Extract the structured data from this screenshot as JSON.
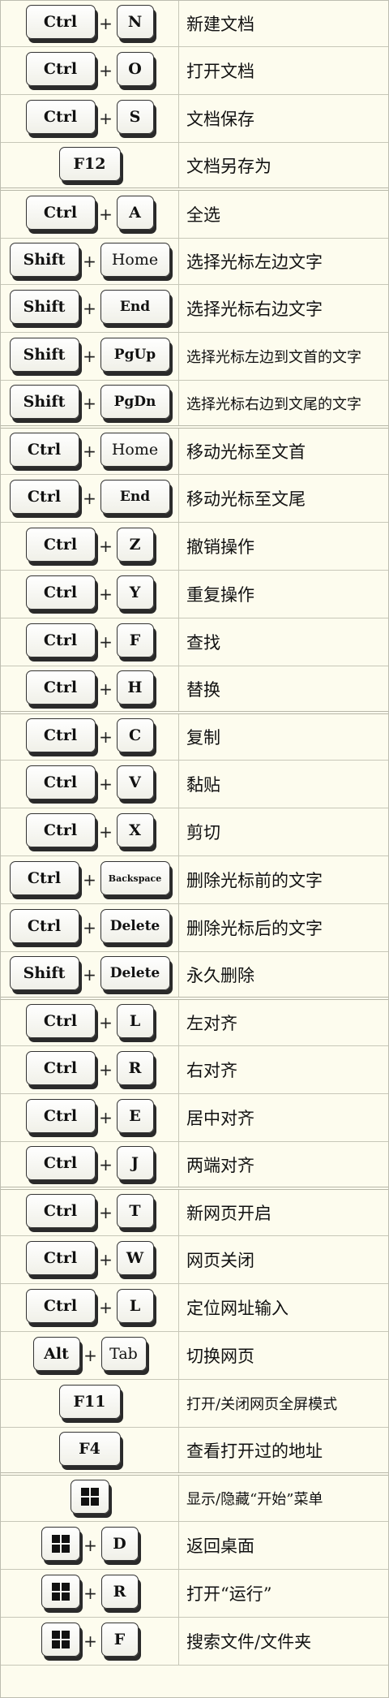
{
  "rows": [
    {
      "keys": [
        "Ctrl",
        "N"
      ],
      "desc": "新建文档"
    },
    {
      "keys": [
        "Ctrl",
        "O"
      ],
      "desc": "打开文档"
    },
    {
      "keys": [
        "Ctrl",
        "S"
      ],
      "desc": "文档保存"
    },
    {
      "keys": [
        "F12"
      ],
      "desc": "文档另存为"
    },
    {
      "keys": [
        "Ctrl",
        "A"
      ],
      "desc": "全选"
    },
    {
      "keys": [
        "Shift",
        "Home"
      ],
      "desc": "选择光标左边文字"
    },
    {
      "keys": [
        "Shift",
        "End"
      ],
      "desc": "选择光标右边文字"
    },
    {
      "keys": [
        "Shift",
        "PgUp"
      ],
      "desc": "选择光标左边到文首的文字"
    },
    {
      "keys": [
        "Shift",
        "PgDn"
      ],
      "desc": "选择光标右边到文尾的文字"
    },
    {
      "keys": [
        "Ctrl",
        "Home"
      ],
      "desc": "移动光标至文首"
    },
    {
      "keys": [
        "Ctrl",
        "End"
      ],
      "desc": "移动光标至文尾"
    },
    {
      "keys": [
        "Ctrl",
        "Z"
      ],
      "desc": "撤销操作"
    },
    {
      "keys": [
        "Ctrl",
        "Y"
      ],
      "desc": "重复操作"
    },
    {
      "keys": [
        "Ctrl",
        "F"
      ],
      "desc": "查找"
    },
    {
      "keys": [
        "Ctrl",
        "H"
      ],
      "desc": "替换"
    },
    {
      "keys": [
        "Ctrl",
        "C"
      ],
      "desc": "复制"
    },
    {
      "keys": [
        "Ctrl",
        "V"
      ],
      "desc": "黏贴"
    },
    {
      "keys": [
        "Ctrl",
        "X"
      ],
      "desc": "剪切"
    },
    {
      "keys": [
        "Ctrl",
        "Backspace"
      ],
      "desc": "删除光标前的文字"
    },
    {
      "keys": [
        "Ctrl",
        "Delete"
      ],
      "desc": "删除光标后的文字"
    },
    {
      "keys": [
        "Shift",
        "Delete"
      ],
      "desc": "永久删除"
    },
    {
      "keys": [
        "Ctrl",
        "L"
      ],
      "desc": "左对齐"
    },
    {
      "keys": [
        "Ctrl",
        "R"
      ],
      "desc": "右对齐"
    },
    {
      "keys": [
        "Ctrl",
        "E"
      ],
      "desc": "居中对齐"
    },
    {
      "keys": [
        "Ctrl",
        "J"
      ],
      "desc": "两端对齐"
    },
    {
      "keys": [
        "Ctrl",
        "T"
      ],
      "desc": "新网页开启"
    },
    {
      "keys": [
        "Ctrl",
        "W"
      ],
      "desc": "网页关闭"
    },
    {
      "keys": [
        "Ctrl",
        "L"
      ],
      "desc": "定位网址输入"
    },
    {
      "keys": [
        "Alt",
        "Tab"
      ],
      "desc": "切换网页"
    },
    {
      "keys": [
        "F11"
      ],
      "desc": "打开/关闭网页全屏模式"
    },
    {
      "keys": [
        "F4"
      ],
      "desc": "查看打开过的地址"
    },
    {
      "keys": [
        "windows-logo-icon"
      ],
      "desc": "显示/隐藏“开始”菜单"
    },
    {
      "keys": [
        "windows-logo-icon",
        "D"
      ],
      "desc": "返回桌面"
    },
    {
      "keys": [
        "windows-logo-icon",
        "R"
      ],
      "desc": "打开“运行”"
    },
    {
      "keys": [
        "windows-logo-icon",
        "F"
      ],
      "desc": "搜索文件/文件夹"
    }
  ]
}
